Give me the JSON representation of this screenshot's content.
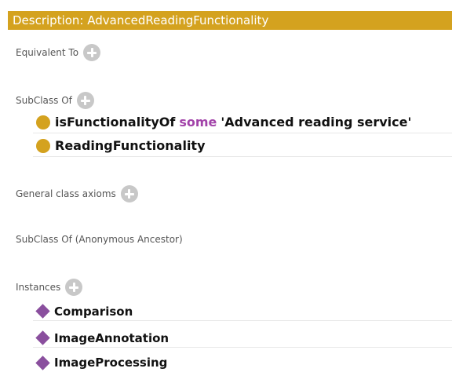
{
  "header": {
    "title": "Description: AdvancedReadingFunctionality"
  },
  "sections": {
    "equivalent_to": "Equivalent To",
    "subclass_of": "SubClass Of",
    "general_class_axioms": "General class axioms",
    "subclass_of_anonymous": "SubClass Of (Anonymous Ancestor)",
    "instances": "Instances"
  },
  "subclass_items": {
    "axiom_property": "isFunctionalityOf",
    "axiom_keyword": "some",
    "axiom_filler": "'Advanced reading service'",
    "superclass": "ReadingFunctionality"
  },
  "instances": [
    "Comparison",
    "ImageAnnotation",
    "ImageProcessing"
  ],
  "colors": {
    "header_bg": "#d4a21f",
    "class_icon": "#d4a21f",
    "individual_icon": "#8a4f9e",
    "keyword": "#a243a9"
  },
  "icons": {
    "add": "plus-circle-icon",
    "class": "class-circle-icon",
    "individual": "individual-diamond-icon"
  }
}
